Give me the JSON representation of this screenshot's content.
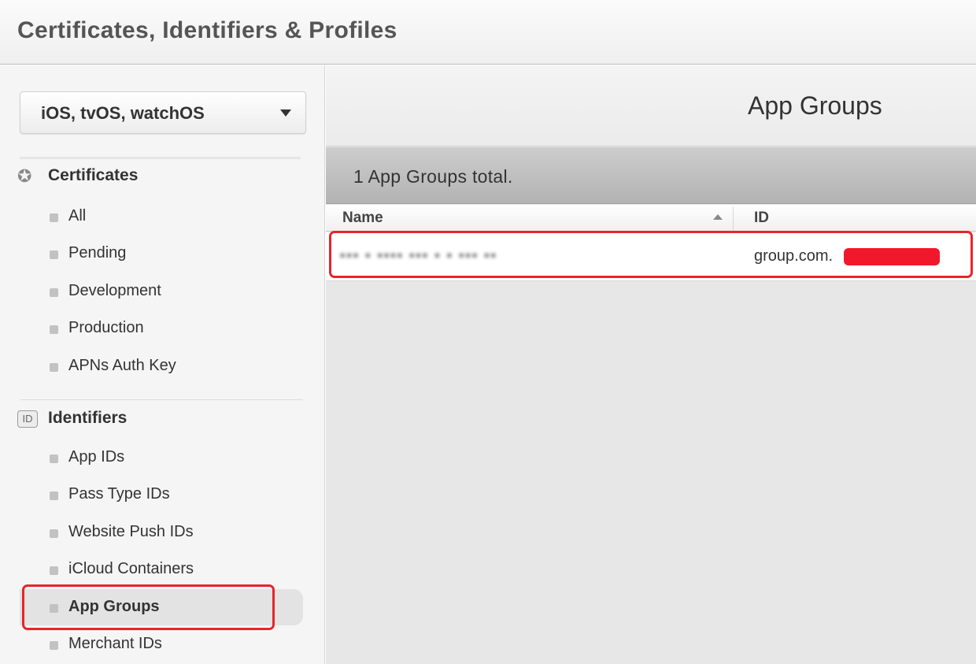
{
  "header": {
    "title": "Certificates, Identifiers & Profiles"
  },
  "sidebar": {
    "platform": "iOS, tvOS, watchOS",
    "certificates": {
      "title": "Certificates",
      "icon": "badge-check-icon",
      "items": [
        {
          "label": "All"
        },
        {
          "label": "Pending"
        },
        {
          "label": "Development"
        },
        {
          "label": "Production"
        },
        {
          "label": "APNs Auth Key"
        }
      ]
    },
    "identifiers": {
      "title": "Identifiers",
      "icon": "id-icon",
      "icon_text": "ID",
      "items": [
        {
          "label": "App IDs"
        },
        {
          "label": "Pass Type IDs"
        },
        {
          "label": "Website Push IDs"
        },
        {
          "label": "iCloud Containers"
        },
        {
          "label": "App Groups",
          "active": true
        },
        {
          "label": "Merchant IDs"
        }
      ]
    }
  },
  "main": {
    "title": "App Groups",
    "total": "1  App Groups total.",
    "table": {
      "columns": [
        "Name",
        "ID"
      ],
      "rows": [
        {
          "name": "▪▪▪ ▪ ▪▪▪▪ ▪▪▪ ▪ ▪ ▪▪▪ ▪▪",
          "id": "group.com."
        }
      ]
    }
  },
  "colors": {
    "highlight": "#e8242b",
    "redaction": "#f2182b"
  }
}
